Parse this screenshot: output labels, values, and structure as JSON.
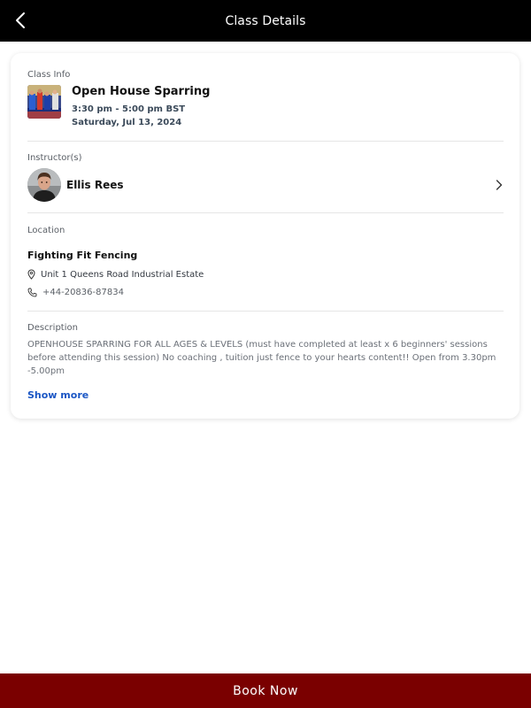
{
  "header": {
    "title": "Class Details",
    "back_icon": "chevron-left-icon"
  },
  "class_info": {
    "label": "Class Info",
    "title": "Open House Sparring",
    "time": "3:30 pm - 5:00 pm BST",
    "date": "Saturday, Jul 13, 2024"
  },
  "instructors": {
    "label": "Instructor(s)",
    "name": "Ellis Rees",
    "chevron_icon": "chevron-right-icon"
  },
  "location": {
    "label": "Location",
    "name": "Fighting Fit Fencing",
    "address": "Unit 1 Queens Road Industrial Estate",
    "phone": "+44-20836-87834",
    "address_icon": "map-pin-icon",
    "phone_icon": "phone-icon"
  },
  "description": {
    "label": "Description",
    "text": "OPENHOUSE SPARRING FOR ALL AGES & LEVELS (must have completed at least x 6 beginners' sessions before attending this session) No coaching , tuition just fence to your hearts content!! Open from 3.30pm -5.00pm",
    "show_more": "Show more"
  },
  "footer": {
    "book_label": "Book Now"
  },
  "colors": {
    "header_bg": "#000000",
    "book_bg": "#7a0000",
    "link": "#1a56c4"
  }
}
